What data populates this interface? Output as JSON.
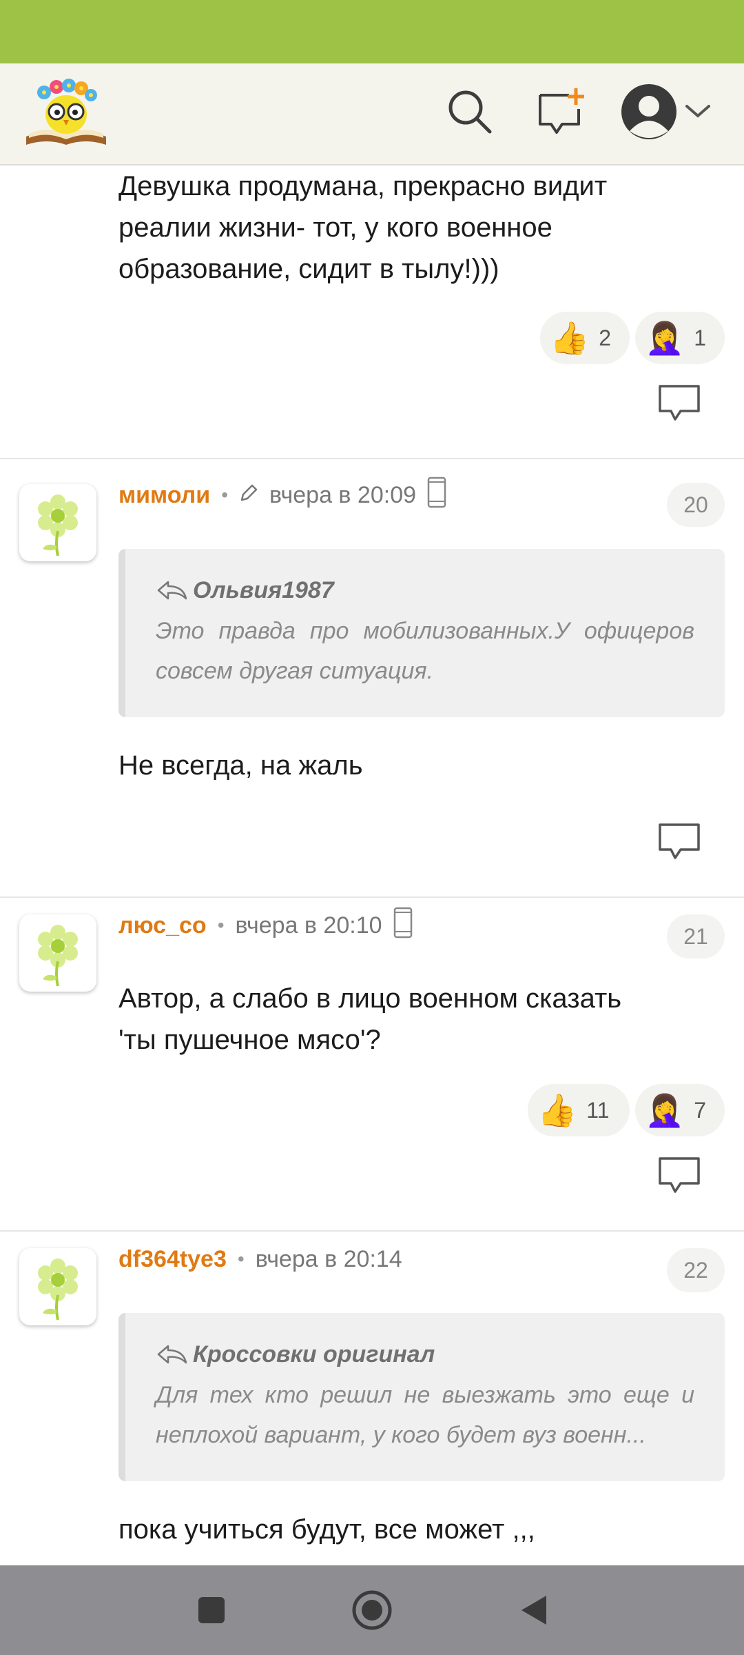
{
  "colors": {
    "status_bar": "#9dc245",
    "header_bg": "#f4f4ed",
    "author": "#e07a12",
    "nav_bar": "#8e8e92"
  },
  "header": {
    "logo": "owl-on-book-logo",
    "icons": [
      "search-icon",
      "new-post-icon",
      "user-avatar-icon",
      "chevron-down-icon"
    ]
  },
  "comments": [
    {
      "text_lines": [
        "Девушка продумана, прекрасно видит",
        "реалии жизни- тот, у кого военное",
        "образование, сидит в тылу!)))"
      ],
      "reactions": [
        {
          "icon": "thumbs-up-emoji",
          "count": "2"
        },
        {
          "icon": "facepalm-emoji",
          "count": "1"
        }
      ]
    },
    {
      "author": "мимоли",
      "separator": "•",
      "time": "вчера в 20:09",
      "edited": true,
      "device": "mobile-icon",
      "number": "20",
      "quote": {
        "author": "Ольвия1987",
        "text": "Это правда про мобилизованных.У офицеров совсем другая ситуация."
      },
      "text": "Не всегда, на жаль"
    },
    {
      "author": "люс_со",
      "separator": "•",
      "time": "вчера в 20:10",
      "device": "mobile-icon",
      "number": "21",
      "text_lines": [
        "Автор, а слабо в лицо военном сказать",
        "'ты пушечное мясо'?"
      ],
      "reactions": [
        {
          "icon": "thumbs-up-emoji",
          "count": "11"
        },
        {
          "icon": "facepalm-emoji",
          "count": "7"
        }
      ]
    },
    {
      "author": "df364tye3",
      "separator": "•",
      "time": "вчера в 20:14",
      "number": "22",
      "quote": {
        "author": "Кроссовки оригинал",
        "text": "Для тех кто решил не выезжать это еще и неплохой вариант, у кого будет вуз военн..."
      },
      "text": "пока учиться будут, все может ,,,"
    }
  ],
  "nav": {
    "icons": [
      "recent-apps-icon",
      "home-icon",
      "back-icon"
    ]
  }
}
